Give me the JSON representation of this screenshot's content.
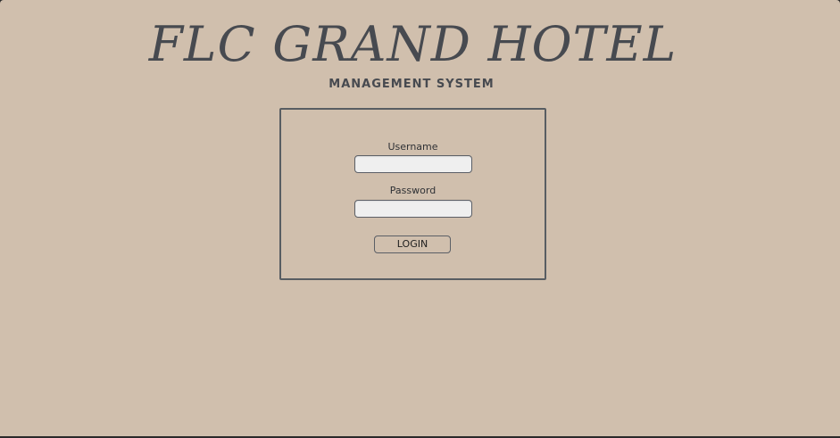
{
  "header": {
    "title": "FLC GRAND HOTEL",
    "subtitle": "MANAGEMENT SYSTEM"
  },
  "login_form": {
    "username_label": "Username",
    "username_value": "",
    "password_label": "Password",
    "password_value": "",
    "login_button_label": "LOGIN"
  },
  "colors": {
    "background": "#d0bfad",
    "text": "#474a50",
    "panel_border": "#585d62",
    "input_background": "#efefef"
  }
}
